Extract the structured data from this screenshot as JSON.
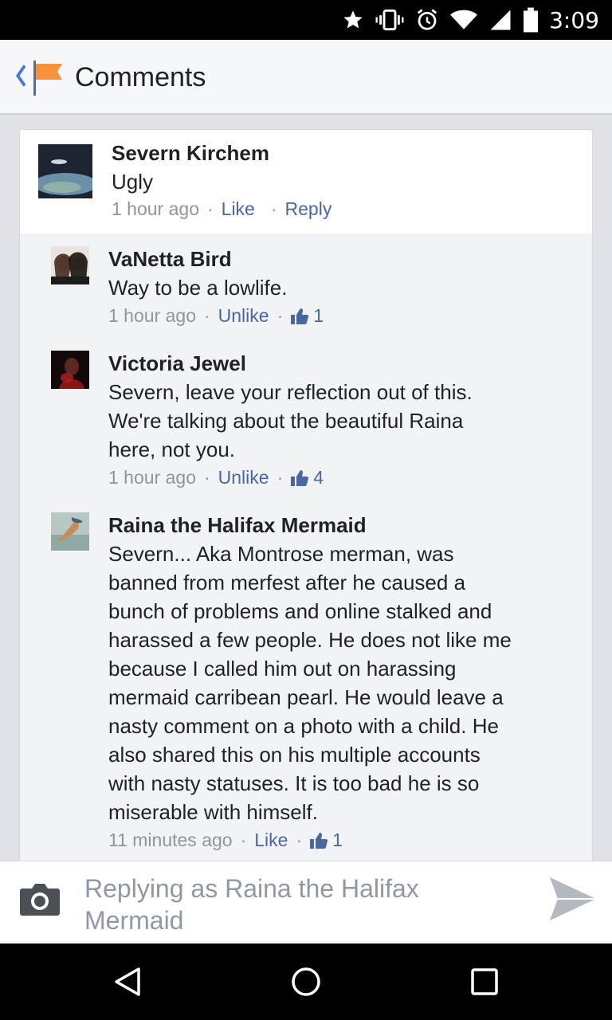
{
  "status_bar": {
    "time": "3:09"
  },
  "app_bar": {
    "title": "Comments"
  },
  "colors": {
    "accent": "#4b67a1",
    "flag": "#f7923a",
    "text": "#1d2129",
    "meta": "#90949c"
  },
  "comment": {
    "name": "Severn Kirchem",
    "text": "Ugly",
    "time": "1 hour ago",
    "like_label": "Like",
    "reply_label": "Reply"
  },
  "replies": [
    {
      "name": "VaNetta Bird",
      "lines": [
        "Way to be a lowlife."
      ],
      "time": "1 hour ago",
      "action": "Unlike",
      "likes": "1"
    },
    {
      "name": "Victoria Jewel",
      "lines": [
        "Severn, leave your reflection out of this.",
        "We're talking about the beautiful Raina",
        "here, not you."
      ],
      "time": "1 hour ago",
      "action": "Unlike",
      "likes": "4"
    },
    {
      "name": "Raina the Halifax Mermaid",
      "lines": [
        "Severn... Aka Montrose merman, was",
        "banned from merfest after he caused a",
        "bunch of problems and online stalked and",
        "harassed a few people. He does not like me",
        "because I called him out on harassing",
        "mermaid carribean pearl. He would leave a",
        "nasty comment on a photo with a child. He",
        "also shared this on his multiple accounts",
        "with nasty statuses. It is too bad he is so",
        "miserable with himself."
      ],
      "time": "11 minutes ago",
      "action": "Like",
      "likes": "1"
    }
  ],
  "composer": {
    "placeholder_line1": "Replying as Raina the Halifax",
    "placeholder_line2": "Mermaid"
  }
}
